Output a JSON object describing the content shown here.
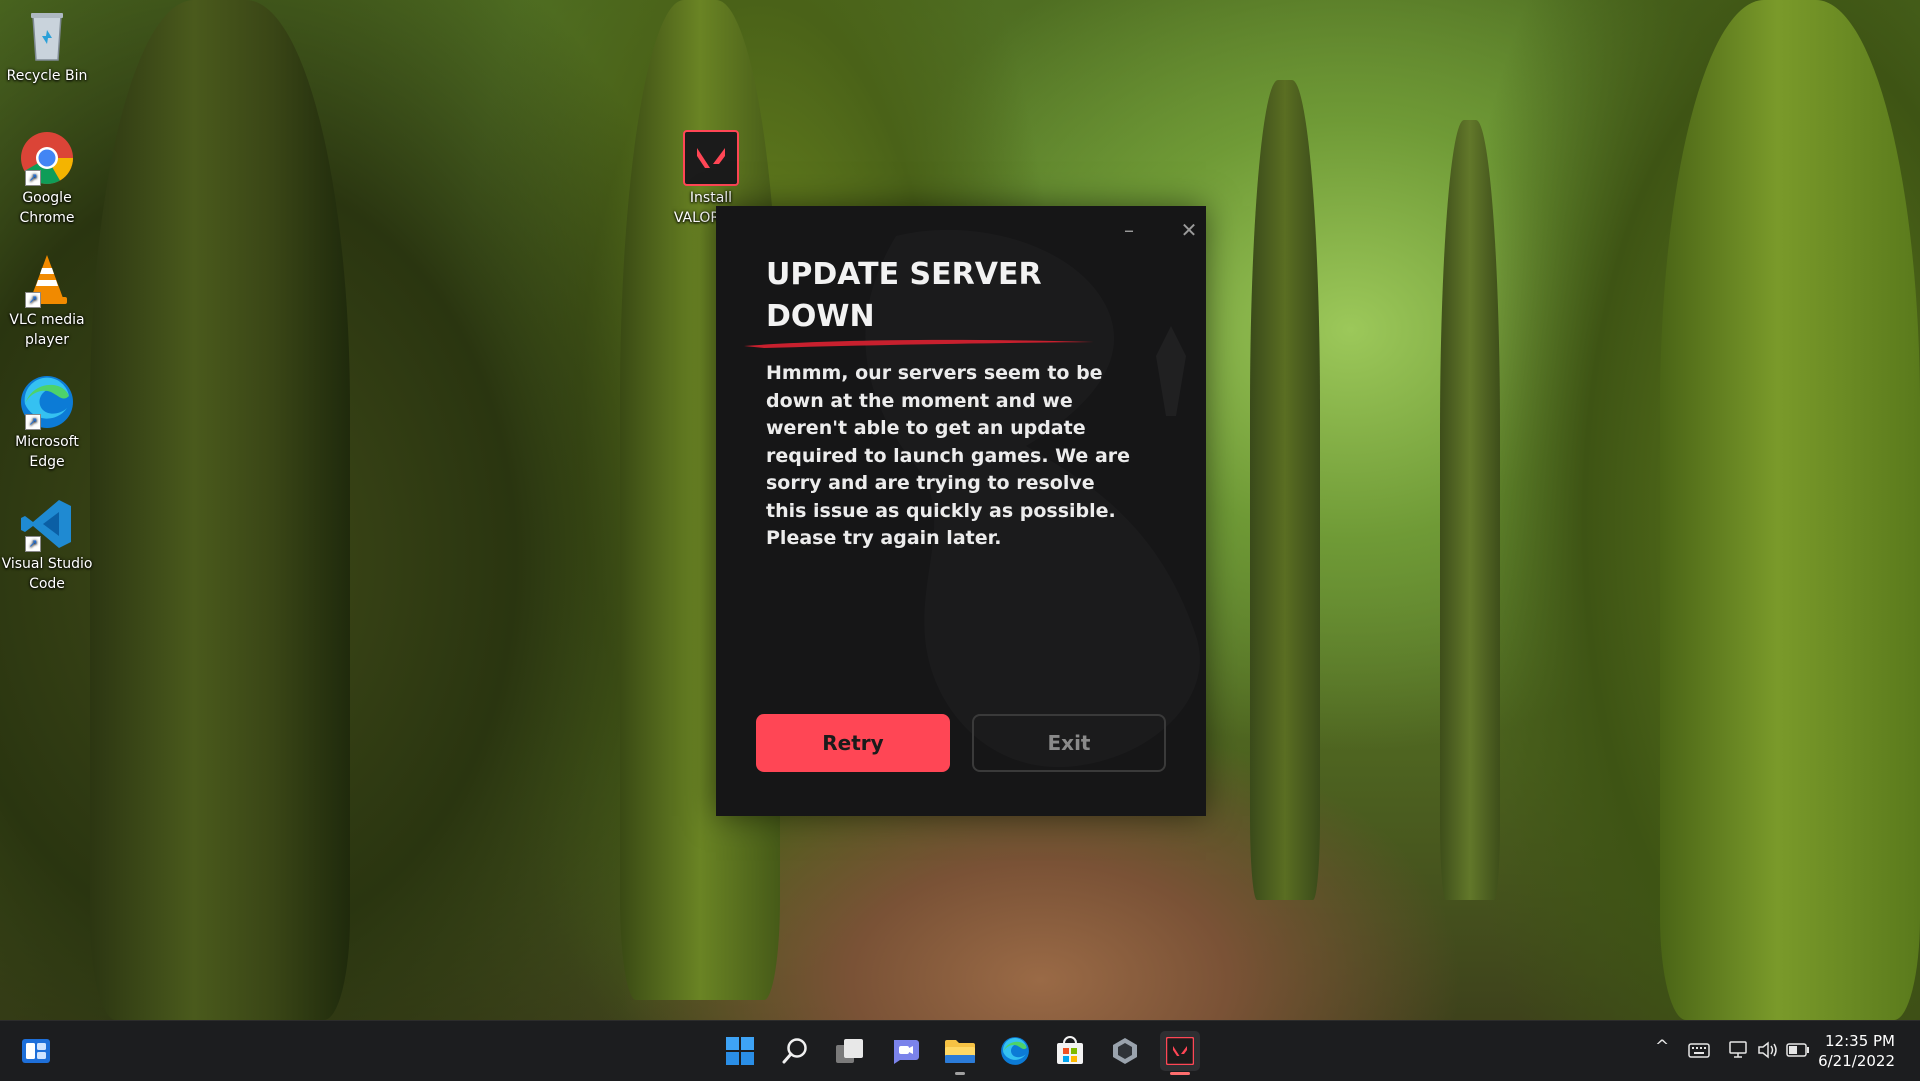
{
  "desktop": {
    "icons": [
      {
        "label": "Recycle Bin"
      },
      {
        "label": "Google Chrome"
      },
      {
        "label": "VLC media player"
      },
      {
        "label": "Microsoft Edge"
      },
      {
        "label": "Visual Studio Code"
      },
      {
        "label": "Install VALORANT"
      }
    ]
  },
  "dialog": {
    "minimize_glyph": "–",
    "close_glyph": "✕",
    "title": "UPDATE SERVER DOWN",
    "message": "Hmmm, our servers seem to be down at the moment and we weren't able to get an update required to launch games. We are sorry and are trying to resolve this issue as quickly as possible. Please try again later.",
    "retry_label": "Retry",
    "exit_label": "Exit",
    "accent_color": "#ff4655"
  },
  "taskbar": {
    "apps": [
      "widgets",
      "start",
      "search",
      "task-view",
      "chat",
      "file-explorer",
      "edge",
      "microsoft-store",
      "riot-client",
      "valorant"
    ],
    "tray": {
      "chevron": "^",
      "time": "12:35 PM",
      "date": "6/21/2022"
    }
  }
}
